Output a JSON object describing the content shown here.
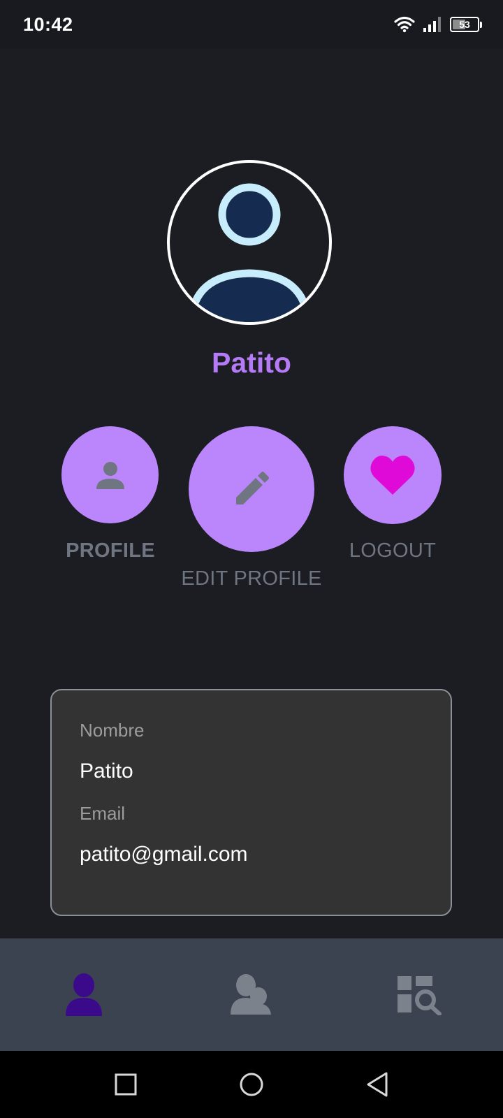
{
  "status_bar": {
    "time": "10:42",
    "battery_level": "53",
    "battery_fraction": 0.53
  },
  "profile": {
    "username": "Patito"
  },
  "actions": {
    "profile_label": "PROFILE",
    "edit_profile_label": "EDIT PROFILE",
    "logout_label": "LOGOUT"
  },
  "info_card": {
    "name_label": "Nombre",
    "name_value": "Patito",
    "email_label": "Email",
    "email_value": "patito@gmail.com"
  },
  "bottom_nav": {
    "items": [
      {
        "icon": "person-icon",
        "active": true
      },
      {
        "icon": "people-icon",
        "active": false
      },
      {
        "icon": "search-dashboard-icon",
        "active": false
      }
    ]
  },
  "colors": {
    "accent": "#bb86fc",
    "username": "#b57bf6",
    "heart": "#e00ad8",
    "active_nav": "#3a0a8a",
    "inactive_nav": "#7c828c"
  }
}
